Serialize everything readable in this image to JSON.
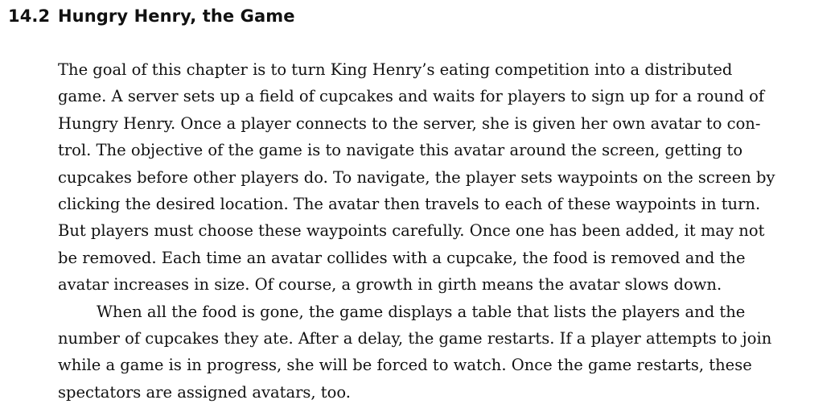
{
  "section": {
    "number": "14.2",
    "title": "Hungry Henry, the Game"
  },
  "paragraphs": [
    {
      "lines": [
        "The goal of this chapter is to turn King Henry’s eating competition into a distributed",
        "game. A server sets up a field of cupcakes and waits for players to sign up for a round of",
        "Hungry Henry. Once a player connects to the server, she is given her own avatar to con-",
        "trol. The objective of the game is to navigate this avatar around the screen, getting to",
        "cupcakes before other players do. To navigate, the player sets waypoints on the screen by",
        "clicking the desired location. The avatar then travels to each of these waypoints in turn.",
        "But players must choose these waypoints carefully. Once one has been added, it may not",
        "be removed. Each time an avatar collides with a cupcake, the food is removed and the",
        "avatar increases in size. Of course, a growth in girth means the avatar slows down."
      ]
    },
    {
      "lines": [
        "When all the food is gone, the game displays a table that lists the players and the",
        "number of cupcakes they ate. After a delay, the game restarts. If a player attempts to join",
        "while a game is in progress, she will be forced to watch. Once the game restarts, these",
        "spectators are assigned avatars, too."
      ]
    }
  ]
}
